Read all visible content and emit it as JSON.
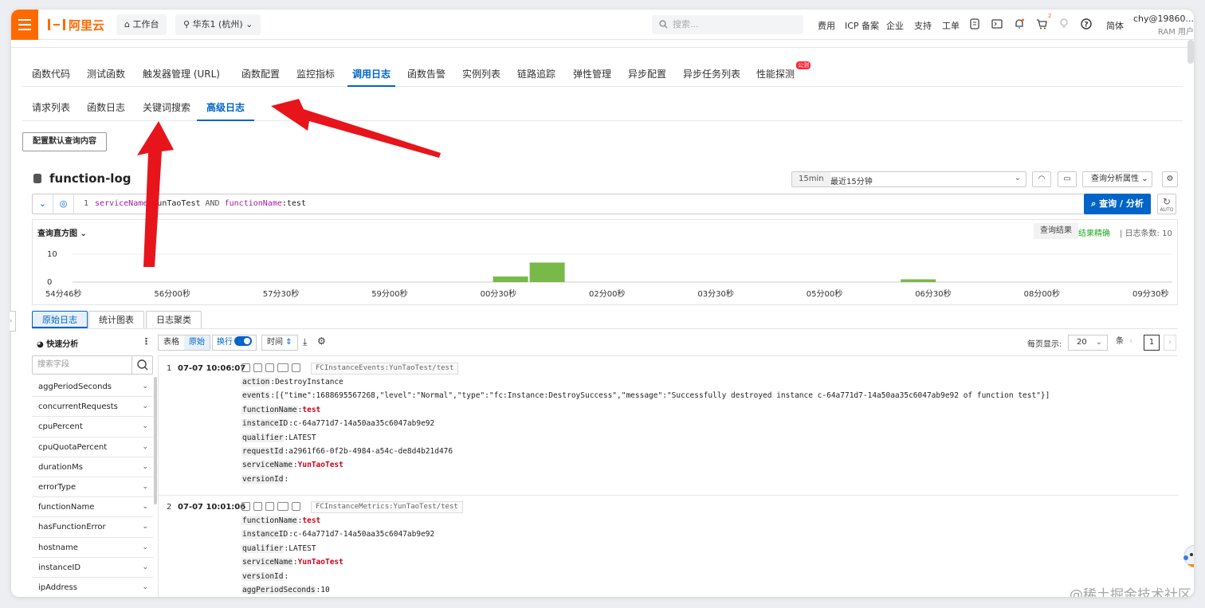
{
  "topbar": {
    "logo": "阿里云",
    "workbench": "工作台",
    "region": "华东1 (杭州)",
    "search_placeholder": "搜索...",
    "nav": [
      "费用",
      "ICP 备案",
      "企业",
      "支持",
      "工单"
    ],
    "lang": "简体",
    "user_name": "chy@19860...",
    "user_type": "RAM 用户",
    "cart_badge": "2"
  },
  "tabs": [
    {
      "label": "函数代码"
    },
    {
      "label": "测试函数"
    },
    {
      "label": "触发器管理 (URL)"
    },
    {
      "label": "函数配置"
    },
    {
      "label": "监控指标"
    },
    {
      "label": "调用日志"
    },
    {
      "label": "函数告警"
    },
    {
      "label": "实例列表"
    },
    {
      "label": "链路追踪"
    },
    {
      "label": "弹性管理"
    },
    {
      "label": "异步配置"
    },
    {
      "label": "异步任务列表"
    },
    {
      "label": "性能探测"
    }
  ],
  "new_badge": "公测",
  "subtabs": [
    {
      "label": "请求列表"
    },
    {
      "label": "函数日志"
    },
    {
      "label": "关键词搜索"
    },
    {
      "label": "高级日志"
    }
  ],
  "config_button": "配置默认查询内容",
  "logstore": {
    "name": "function-log",
    "time_tag": "15min",
    "time_value": "最近15分钟",
    "attr_button": "查询分析属性"
  },
  "query": {
    "line": "1",
    "key1": "serviceName",
    "val1": ":YunTaoTest",
    "op": " AND ",
    "key2": "functionName",
    "val2": ":test",
    "submit": "查询 / 分析",
    "auto": "AUTO"
  },
  "histogram": {
    "title": "查询直方图",
    "result_btn": "查询结果",
    "exact": "结果精确",
    "count_label": "日志条数: 10",
    "y_ticks": [
      "10",
      "0"
    ],
    "x_labels": [
      "54分46秒",
      "56分00秒",
      "57分30秒",
      "59分00秒",
      "00分30秒",
      "02分00秒",
      "03分30秒",
      "05分00秒",
      "06分30秒",
      "08分00秒",
      "09分30秒"
    ]
  },
  "chart_data": {
    "type": "bar",
    "title": "查询直方图",
    "ylim": [
      0,
      10
    ],
    "x_ticks": [
      "54分46秒",
      "56分00秒",
      "57分30秒",
      "59分00秒",
      "00分30秒",
      "02分00秒",
      "03分30秒",
      "05分00秒",
      "06分30秒",
      "08分00秒",
      "09分30秒"
    ],
    "bars": [
      {
        "x": "00分30秒 – 01分00秒",
        "value": 2
      },
      {
        "x": "01分00秒 – 01分30秒",
        "value": 7
      },
      {
        "x": "06分30秒 – 07分00秒",
        "value": 1
      }
    ],
    "color": "#78b94a"
  },
  "lower_tabs": [
    {
      "label": "原始日志"
    },
    {
      "label": "统计图表"
    },
    {
      "label": "日志聚类"
    }
  ],
  "left_panel": {
    "title": "快速分析",
    "search_placeholder": "搜索字段",
    "fields": [
      "aggPeriodSeconds",
      "concurrentRequests",
      "cpuPercent",
      "cpuQuotaPercent",
      "durationMs",
      "errorType",
      "functionName",
      "hasFunctionError",
      "hostname",
      "instanceID",
      "ipAddress"
    ]
  },
  "toolbar": {
    "table": "表格",
    "raw": "原始",
    "wrap": "换行",
    "time": "时间",
    "per_page_label": "每页显示:",
    "per_page": "20",
    "unit": "条",
    "page": "1"
  },
  "logs": [
    {
      "index": "1",
      "time": "07-07 10:06:07",
      "tag": "FCInstanceEvents:YunTaoTest/test",
      "fields": [
        {
          "k": "action",
          "v": "DestroyInstance",
          "red": false
        },
        {
          "k": "events",
          "v": "[{\"time\":1688695567268,\"level\":\"Normal\",\"type\":\"fc:Instance:DestroySuccess\",\"message\":\"Successfully destroyed instance c-64a771d7-14a50aa35c6047ab9e92 of function test\"}]",
          "red": false
        },
        {
          "k": "functionName",
          "v": "test",
          "red": true
        },
        {
          "k": "instanceID",
          "v": "c-64a771d7-14a50aa35c6047ab9e92",
          "red": false
        },
        {
          "k": "qualifier",
          "v": "LATEST",
          "red": false
        },
        {
          "k": "requestId",
          "v": "a2961f66-0f2b-4984-a54c-de8d4b21d476",
          "red": false
        },
        {
          "k": "serviceName",
          "v": "YunTaoTest",
          "red": true
        },
        {
          "k": "versionId",
          "v": "",
          "red": false
        }
      ]
    },
    {
      "index": "2",
      "time": "07-07 10:01:06",
      "tag": "FCInstanceMetrics:YunTaoTest/test",
      "fields": [
        {
          "k": "functionName",
          "v": "test",
          "red": true
        },
        {
          "k": "instanceID",
          "v": "c-64a771d7-14a50aa35c6047ab9e92",
          "red": false
        },
        {
          "k": "qualifier",
          "v": "LATEST",
          "red": false
        },
        {
          "k": "serviceName",
          "v": "YunTaoTest",
          "red": true
        },
        {
          "k": "versionId",
          "v": "",
          "red": false
        },
        {
          "k": "aggPeriodSeconds",
          "v": "10",
          "red": false
        }
      ]
    }
  ],
  "watermark": "@稀土掘金技术社区"
}
